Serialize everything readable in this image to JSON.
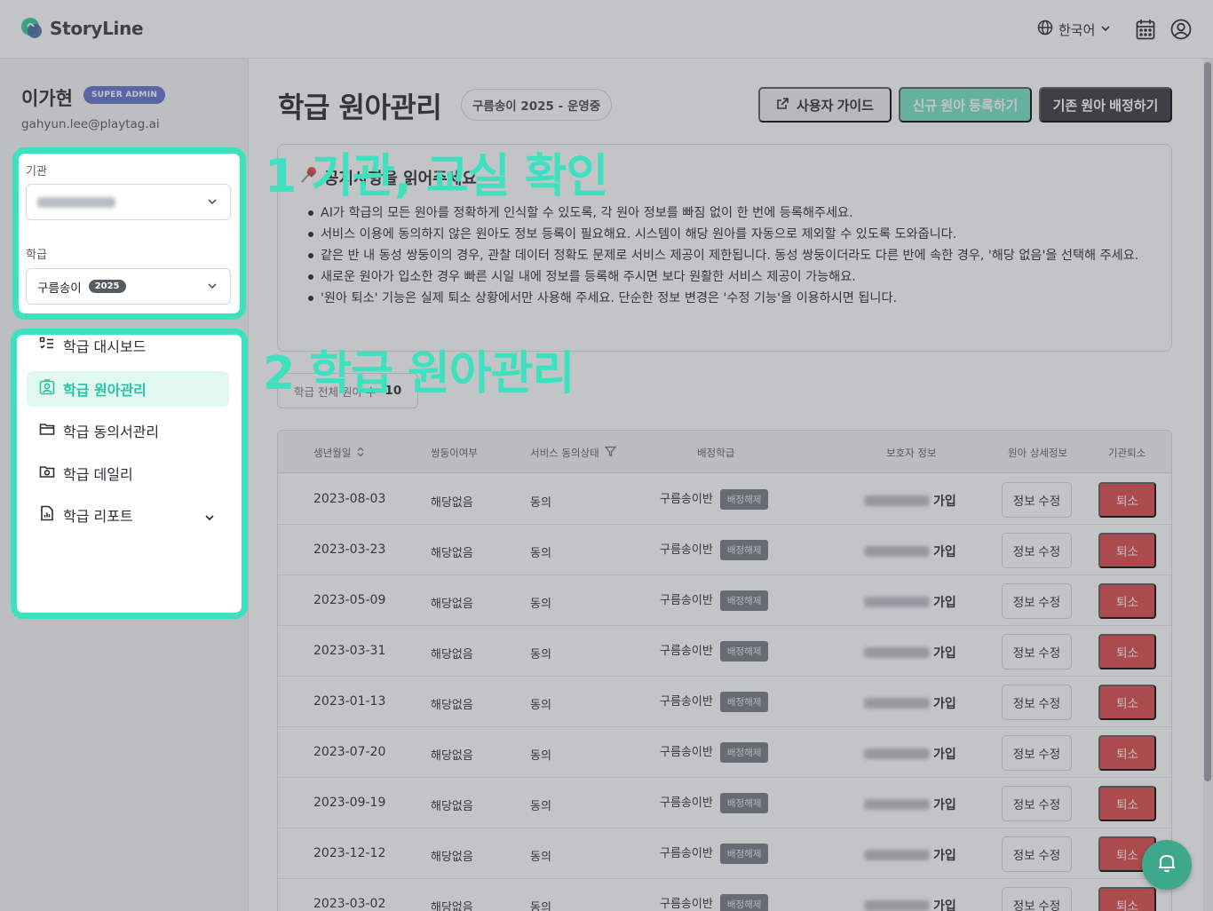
{
  "header": {
    "app_name": "StoryLine",
    "language": "한국어"
  },
  "user": {
    "name": "이가현",
    "role": "SUPER ADMIN",
    "email": "gahyun.lee@playtag.ai"
  },
  "filters": {
    "institution_label": "기관",
    "class_label": "학급",
    "class_value": "구름송이",
    "class_year": "2025"
  },
  "nav": [
    {
      "label": "학급 대시보드",
      "icon": "dashboard-list-icon"
    },
    {
      "label": "학급 원아관리",
      "icon": "child-profile-icon",
      "active": true
    },
    {
      "label": "학급 동의서관리",
      "icon": "folder-icon"
    },
    {
      "label": "학급 데일리",
      "icon": "camera-folder-icon"
    },
    {
      "label": "학급 리포트",
      "icon": "report-chart-icon",
      "expandable": true
    }
  ],
  "page": {
    "title": "학급 원아관리",
    "badge": "구름송이 2025 - 운영중",
    "guide_button": "사용자 가이드",
    "register_button": "신규 원아 등록하기",
    "assign_button": "기존 원아 배정하기"
  },
  "notice": {
    "title": "공지사항을 읽어주세요",
    "items": [
      "AI가 학급의 모든 원아를 정확하게 인식할 수 있도록, 각 원아 정보를 빠짐 없이 한 번에 등록해주세요.",
      "서비스 이용에 동의하지 않은 원아도 정보 등록이 필요해요. 시스템이 해당 원아를 자동으로 제외할 수 있도록 도와줍니다.",
      "같은 반 내 동성 쌍둥이의 경우, 관찰 데이터 정확도 문제로 서비스 제공이 제한됩니다. 동성 쌍둥이더라도 다른 반에 속한 경우, '해당 없음'을 선택해 주세요.",
      "새로운 원아가 입소한 경우 빠른 시일 내에 정보를 등록해 주시면 보다 원활한 서비스 제공이 가능해요.",
      "'원아 퇴소' 기능은 실제 퇴소 상황에서만 사용해 주세요. 단순한 정보 변경은 '수정 기능'을 이용하시면 됩니다."
    ]
  },
  "count": {
    "label": "학급 전체 원아 수",
    "value": "10"
  },
  "annotations": {
    "step1": "1  기관, 교실 확인",
    "step2": "2  학급 원아관리"
  },
  "table": {
    "headers": {
      "birth": "생년월일",
      "twin": "쌍둥이여부",
      "consent": "서비스 동의상태",
      "class": "배정학급",
      "guardian": "보호자 정보",
      "detail": "원아 상세정보",
      "leave": "기관퇴소"
    },
    "rows": [
      {
        "birth": "2023-08-03",
        "twin": "해당없음",
        "consent": "동의",
        "class": "구름송이반",
        "tag": "배정해제",
        "guardian_status": "가입",
        "edit": "정보 수정",
        "leave": "퇴소"
      },
      {
        "birth": "2023-03-23",
        "twin": "해당없음",
        "consent": "동의",
        "class": "구름송이반",
        "tag": "배정해제",
        "guardian_status": "가입",
        "edit": "정보 수정",
        "leave": "퇴소"
      },
      {
        "birth": "2023-05-09",
        "twin": "해당없음",
        "consent": "동의",
        "class": "구름송이반",
        "tag": "배정해제",
        "guardian_status": "가입",
        "edit": "정보 수정",
        "leave": "퇴소"
      },
      {
        "birth": "2023-03-31",
        "twin": "해당없음",
        "consent": "동의",
        "class": "구름송이반",
        "tag": "배정해제",
        "guardian_status": "가입",
        "edit": "정보 수정",
        "leave": "퇴소"
      },
      {
        "birth": "2023-01-13",
        "twin": "해당없음",
        "consent": "동의",
        "class": "구름송이반",
        "tag": "배정해제",
        "guardian_status": "가입",
        "edit": "정보 수정",
        "leave": "퇴소"
      },
      {
        "birth": "2023-07-20",
        "twin": "해당없음",
        "consent": "동의",
        "class": "구름송이반",
        "tag": "배정해제",
        "guardian_status": "가입",
        "edit": "정보 수정",
        "leave": "퇴소"
      },
      {
        "birth": "2023-09-19",
        "twin": "해당없음",
        "consent": "동의",
        "class": "구름송이반",
        "tag": "배정해제",
        "guardian_status": "가입",
        "edit": "정보 수정",
        "leave": "퇴소"
      },
      {
        "birth": "2023-12-12",
        "twin": "해당없음",
        "consent": "동의",
        "class": "구름송이반",
        "tag": "배정해제",
        "guardian_status": "가입",
        "edit": "정보 수정",
        "leave": "퇴소"
      },
      {
        "birth": "2023-03-02",
        "twin": "해당없음",
        "consent": "동의",
        "class": "구름송이반",
        "tag": "배정해제",
        "guardian_status": "가입",
        "edit": "정보 수정",
        "leave": "퇴소"
      }
    ]
  },
  "colors": {
    "accent": "#3de0bf",
    "primary_dark": "#2e3137",
    "danger": "#d94242",
    "role_badge": "#5b6bc9"
  }
}
